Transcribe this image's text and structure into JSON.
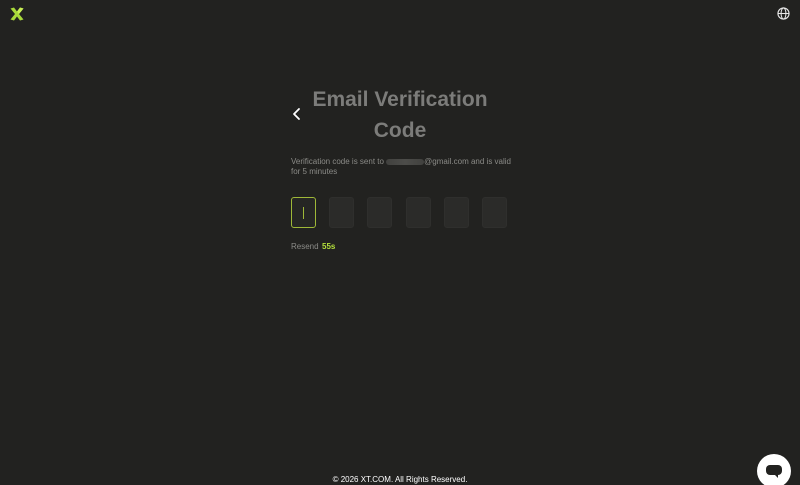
{
  "app": {
    "logo": "xt-logo-icon",
    "language_icon": "globe-icon",
    "brand_color": "#b5e13c"
  },
  "page": {
    "back_icon": "chevron-left-icon",
    "title_line1": "Email Verification",
    "title_line2": "Code",
    "desc_prefix": "Verification code is sent to ",
    "desc_email_suffix": "@gmail.com and is valid for 5 minutes"
  },
  "code": {
    "digits": [
      "",
      "",
      "",
      "",
      "",
      ""
    ],
    "active_index": 0
  },
  "resend": {
    "label": "Resend",
    "countdown": "55s"
  },
  "footer": {
    "copyright": "© 2026 XT.COM. All Rights Reserved."
  },
  "support": {
    "chat_icon": "chat-bubble-icon"
  }
}
